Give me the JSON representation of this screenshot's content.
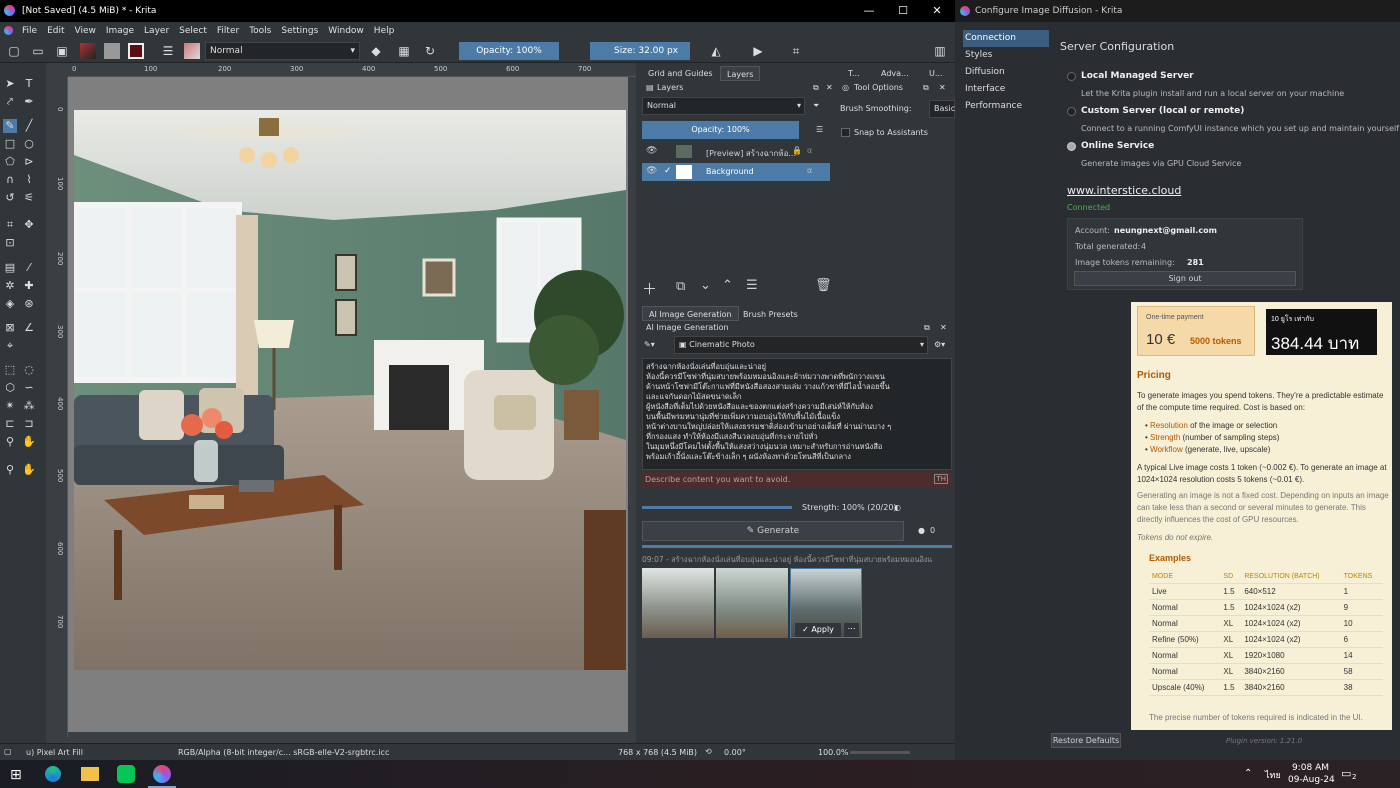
{
  "krita": {
    "title": "[Not Saved]  (4.5 MiB) * - Krita",
    "menu": [
      "File",
      "Edit",
      "View",
      "Image",
      "Layer",
      "Select",
      "Filter",
      "Tools",
      "Settings",
      "Window",
      "Help"
    ],
    "blend_mode": "Normal",
    "opacity": "Opacity: 100%",
    "size": "Size: 32.00 px",
    "ruler_h": [
      "0",
      "100",
      "200",
      "300",
      "400",
      "500",
      "600",
      "700"
    ],
    "ruler_v": [
      "0",
      "100",
      "200",
      "300",
      "400",
      "500",
      "600",
      "700"
    ],
    "tabs_top": [
      "Grid and Guides",
      "Layers",
      "T...",
      "Adva...",
      "U..."
    ],
    "layers": {
      "title": "Layers",
      "blend": "Normal",
      "opacity": "Opacity:  100%",
      "items": [
        {
          "name": "[Preview] สร้างฉากห้อ..."
        },
        {
          "name": "Background"
        }
      ]
    },
    "tool_options": {
      "title": "Tool Options",
      "brush_smoothing": "Brush Smoothing:",
      "smoothing_value": "Basic",
      "snap": "Snap to Assistants"
    },
    "tabs_mid": [
      "AI Image Generation",
      "Brush Presets"
    ],
    "ai": {
      "title": "AI Image Generation",
      "style": "Cinematic Photo",
      "prompt": "สร้างฉากห้องนั่งเล่นที่อบอุ่นและน่าอยู่\nห้องนี้ควรมีโซฟาที่นุ่มสบายพร้อมหมอนอิงและผ้าห่มวางพาดที่พนักวางแขน\nด้านหน้าโซฟามีโต๊ะกาแฟที่มีหนังสือสองสามเล่ม วางแก้วชาที่มีไอน้ำลอยขึ้น\nและแจกันดอกไม้สดขนาดเล็ก\nผู้หนังสือที่เต็มไปด้วยหนังสือและของตกแต่งสร้างความมีเสน่ห์ให้กับห้อง\nบนพื้นมีพรมหนานุ่มที่ช่วยเพิ่มความอบอุ่นให้กับพื้นไม้เนื้อแข็ง\nหน้าต่างบานใหญ่ปล่อยให้แสงธรรมชาติส่องเข้ามาอย่างเต็มที่ ผ่านม่านบาง ๆ\nที่กรองแสง ทำให้ห้องมีแสงสีนวลอบอุ่นที่กระจายไปทั่ว\nในมุมหนึ่งมีโคมไฟตั้งพื้นให้แสงสว่างนุ่มนวล เหมาะสำหรับการอ่านหนังสือ\nพร้อมเก้าอี้นั่งและโต๊ะข้างเล็ก ๆ ผนังห้องทาด้วยโทนสีที่เป็นกลาง",
      "negative_placeholder": "Describe content you want to avoid.",
      "lang": "TH",
      "strength": "Strength: 100% (20/20)",
      "generate": "Generate",
      "queue": "0",
      "history_label": "09:07 - สร้างฉากห้องนั่งเล่นที่อบอุ่นและน่าอยู่ ห้องนี้ควรมีโซฟาที่นุ่มสบายพร้อมหมอนอิงแ",
      "apply": "Apply"
    },
    "status": {
      "tool": "u) Pixel Art Fill",
      "color": "RGB/Alpha (8-bit integer/c...  sRGB-elle-V2-srgbtrc.icc",
      "dims": "768 x 768 (4.5 MiB)",
      "angle": "0.00°",
      "zoom": "100.0%"
    }
  },
  "config": {
    "title": "Configure Image Diffusion - Krita",
    "nav": [
      "Connection",
      "Styles",
      "Diffusion",
      "Interface",
      "Performance"
    ],
    "heading": "Server Configuration",
    "options": [
      {
        "label": "Local Managed Server",
        "desc": "Let the Krita plugin install and run a local server on your machine"
      },
      {
        "label": "Custom Server (local or remote)",
        "desc": "Connect to a running ComfyUI instance which you set up and maintain yourself"
      },
      {
        "label": "Online Service",
        "desc": "Generate images via GPU Cloud Service"
      }
    ],
    "link": "www.interstice.cloud",
    "status": "Connected",
    "account_label": "Account:",
    "account": "neungnext@gmail.com",
    "total_label": "Total generated:",
    "total": "4",
    "tokens_label": "Image tokens remaining:",
    "tokens": "281",
    "signout": "Sign out",
    "restore": "Restore Defaults",
    "version": "Plugin version: 1.21.0"
  },
  "pricing": {
    "onetime": "One-time payment",
    "price": "10 €",
    "price_tokens": "5000 tokens",
    "thai_label": "10 ยูโร เท่ากับ",
    "thai_value": "384.44 บาท",
    "title": "Pricing",
    "intro": "To generate images you spend tokens. They're a predictable estimate of the compute time required. Cost is based on:",
    "bullets": [
      {
        "k": "Resolution",
        "v": " of the image or selection"
      },
      {
        "k": "Strength",
        "v": " (number of sampling steps)"
      },
      {
        "k": "Workflow",
        "v": " (generate, live, upscale)"
      }
    ],
    "typical": "A typical Live image costs 1 token (~0.002 €). To generate an image at 1024×1024 resolution costs 5 tokens (~0.01 €).",
    "note": "Generating an image is not a fixed cost. Depending on inputs an image can take less than a second or several minutes to generate. This directly influences the cost of GPU resources.",
    "expire": "Tokens do not expire.",
    "examples": "Examples",
    "headers": [
      "MODE",
      "SD",
      "RESOLUTION (BATCH)",
      "TOKENS"
    ],
    "rows": [
      [
        "Live",
        "1.5",
        "640×512",
        "1"
      ],
      [
        "Normal",
        "1.5",
        "1024×1024 (x2)",
        "9"
      ],
      [
        "Normal",
        "XL",
        "1024×1024 (x2)",
        "10"
      ],
      [
        "Refine (50%)",
        "XL",
        "1024×1024 (x2)",
        "6"
      ],
      [
        "Normal",
        "XL",
        "1920×1080",
        "14"
      ],
      [
        "Normal",
        "XL",
        "3840×2160",
        "58"
      ],
      [
        "Upscale (40%)",
        "1.5",
        "3840×2160",
        "38"
      ]
    ],
    "footer": "The precise number of tokens required is indicated in the UI."
  },
  "taskbar": {
    "lang": "ไทย",
    "time": "9:08 AM",
    "date": "09-Aug-24",
    "notif": "2"
  },
  "colors": {
    "accent": "#4d7ba8",
    "connected": "#4caf50",
    "pricing_bg": "#f7efd6"
  }
}
